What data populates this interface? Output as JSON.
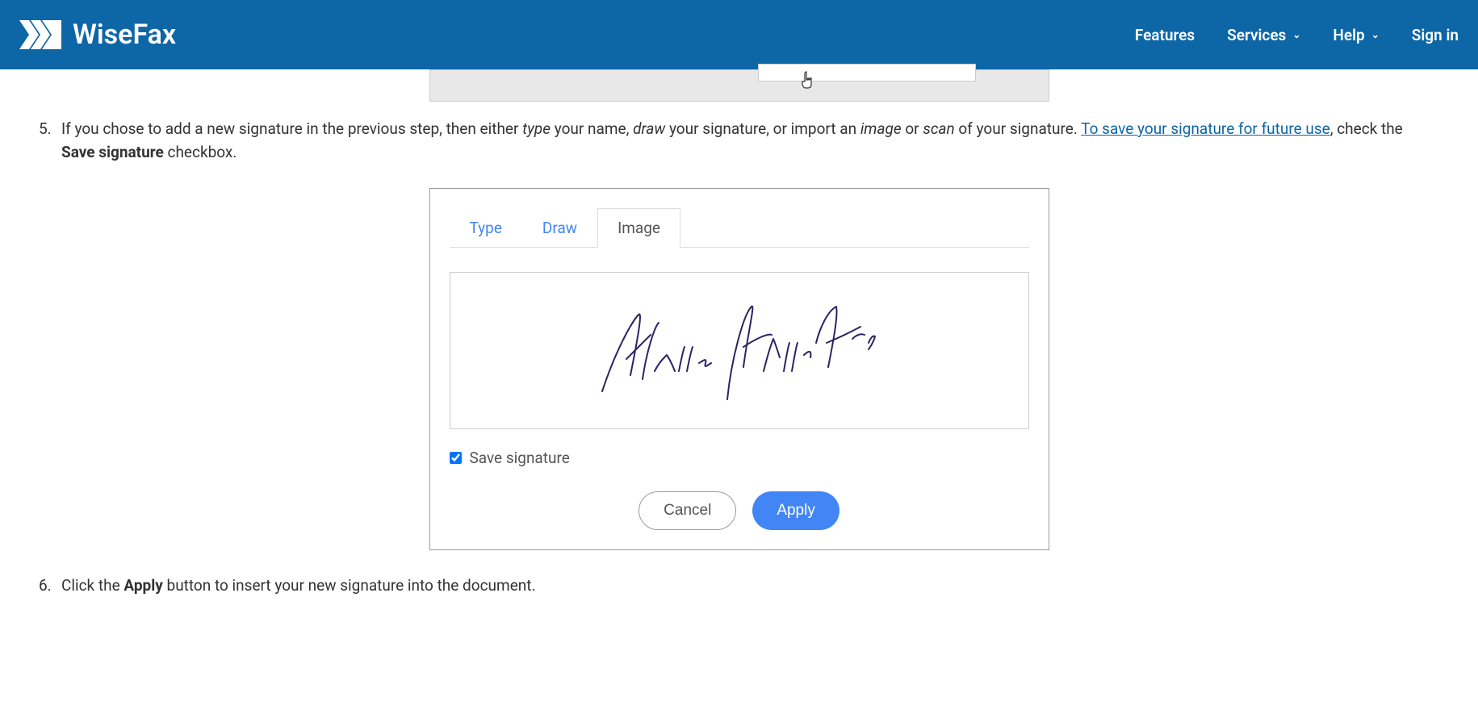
{
  "header": {
    "logo_text": "WiseFax",
    "nav": {
      "features": "Features",
      "services": "Services",
      "help": "Help",
      "signin": "Sign in"
    }
  },
  "step5": {
    "number": "5.",
    "text_part1": "If you chose to add a new signature in the previous step, then either ",
    "type_italic": "type",
    "text_part2": " your name, ",
    "draw_italic": "draw",
    "text_part3": " your signature, or import an ",
    "image_italic": "image",
    "text_part4": " or ",
    "scan_italic": "scan",
    "text_part5": " of your signature. ",
    "link_text": "To save your signature for future use",
    "text_part6": ", check the ",
    "bold_text": "Save signature",
    "text_part7": " checkbox."
  },
  "signature_panel": {
    "tabs": {
      "type": "Type",
      "draw": "Draw",
      "image": "Image"
    },
    "checkbox_label": "Save signature",
    "cancel_button": "Cancel",
    "apply_button": "Apply"
  },
  "step6": {
    "number": "6.",
    "text_part1": "Click the ",
    "bold_text": "Apply",
    "text_part2": " button to insert your new signature into the document."
  }
}
